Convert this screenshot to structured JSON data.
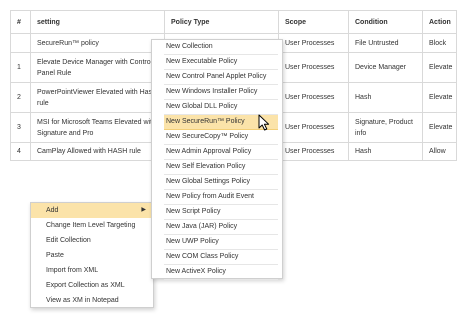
{
  "table": {
    "columns": [
      "#",
      "setting",
      "Policy Type",
      "Scope",
      "Condition",
      "Action"
    ],
    "rows": [
      [
        "",
        "SecureRun™ policy",
        "",
        "User Processes",
        "File Untrusted",
        "Block"
      ],
      [
        "1",
        "Elevate Device Manager with Control Panel Rule",
        "",
        "User Processes",
        "Device Manager",
        "Elevate"
      ],
      [
        "2",
        "PowerPointViewer Elevated with Hash rule",
        "",
        "User Processes",
        "Hash",
        "Elevate"
      ],
      [
        "3",
        "MSI for Microsoft Teams Elevated with Signature and Pro",
        "",
        "User Processes",
        "Signature, Product info",
        "Elevate"
      ],
      [
        "4",
        "CamPlay Allowed with HASH rule",
        "",
        "User Processes",
        "Hash",
        "Allow"
      ]
    ]
  },
  "context_menu": {
    "items": [
      {
        "label": "Add",
        "submenu_arrow": "▶",
        "active": true
      },
      {
        "label": "Change Item Level Targeting"
      },
      {
        "label": "Edit Collection"
      },
      {
        "label": "Paste"
      },
      {
        "label": "Import from XML"
      },
      {
        "label": "Export Collection as XML"
      },
      {
        "label": "View as XM in Notepad"
      }
    ]
  },
  "submenu": {
    "items": [
      {
        "label": "New Collection"
      },
      {
        "label": "New Executable Policy"
      },
      {
        "label": "New Control Panel Applet Policy"
      },
      {
        "label": "New Windows Installer Policy"
      },
      {
        "label": "New Global DLL Policy"
      },
      {
        "label": "New SecureRun™ Policy",
        "active": true
      },
      {
        "label": "New SecureCopy™ Policy"
      },
      {
        "label": "New Admin Approval Policy"
      },
      {
        "label": "New Self Elevation Policy"
      },
      {
        "label": "New Global Settings Policy"
      },
      {
        "label": "New Policy from Audit Event"
      },
      {
        "label": "New Script Policy"
      },
      {
        "label": "New Java (JAR) Policy"
      },
      {
        "label": "New UWP Policy"
      },
      {
        "label": "New COM Class Policy"
      },
      {
        "label": "New ActiveX Policy"
      }
    ]
  },
  "colors": {
    "highlight": "#fbe3a9",
    "border": "#d9d9d9",
    "text": "#333333"
  },
  "icons": {
    "cursor": "mouse-pointer-icon"
  }
}
